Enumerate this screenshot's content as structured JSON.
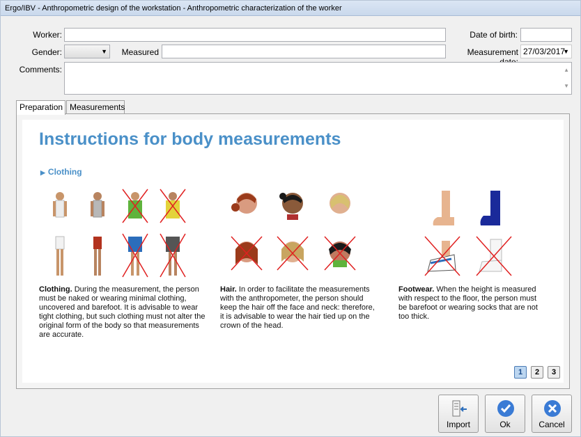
{
  "window": {
    "title": "Ergo/IBV - Anthropometric design of the workstation - Anthropometric characterization of the worker"
  },
  "form": {
    "worker_label": "Worker:",
    "worker_value": "",
    "dob_label": "Date of birth:",
    "dob_value": "",
    "gender_label": "Gender:",
    "gender_value": "",
    "measured_label": "Measured",
    "measured_value": "",
    "measurement_date_label": "Measurement date:",
    "measurement_date_value": "27/03/2017",
    "comments_label": "Comments:",
    "comments_value": ""
  },
  "tabs": [
    {
      "label": "Preparation",
      "active": true
    },
    {
      "label": "Measurements",
      "active": false
    }
  ],
  "instructions": {
    "title": "Instructions for body measurements",
    "section": "Clothing",
    "columns": [
      {
        "heading": "Clothing.",
        "text": "During the measurement, the person must be naked or wearing minimal clothing, uncovered and barefoot. It is advisable to wear tight clothing, but such clothing must not alter the original form of the body so that measurements are accurate."
      },
      {
        "heading": "Hair.",
        "text": "In order to facilitate the measurements with the anthropometer, the person should keep the hair off the face and neck: therefore, it is advisable to wear the hair tied up on the crown of the head."
      },
      {
        "heading": "Footwear.",
        "text": "When the height is measured with respect to the floor, the person must be barefoot or wearing socks that are not too thick."
      }
    ],
    "pages": [
      "1",
      "2",
      "3"
    ],
    "current_page": "1"
  },
  "buttons": {
    "import_label": "Import",
    "ok_label": "Ok",
    "cancel_label": "Cancel"
  },
  "colors": {
    "heading": "#4a90c8",
    "ok_icon": "#3a7bd5",
    "cancel_icon": "#3a7bd5",
    "cross": "#e02020"
  }
}
